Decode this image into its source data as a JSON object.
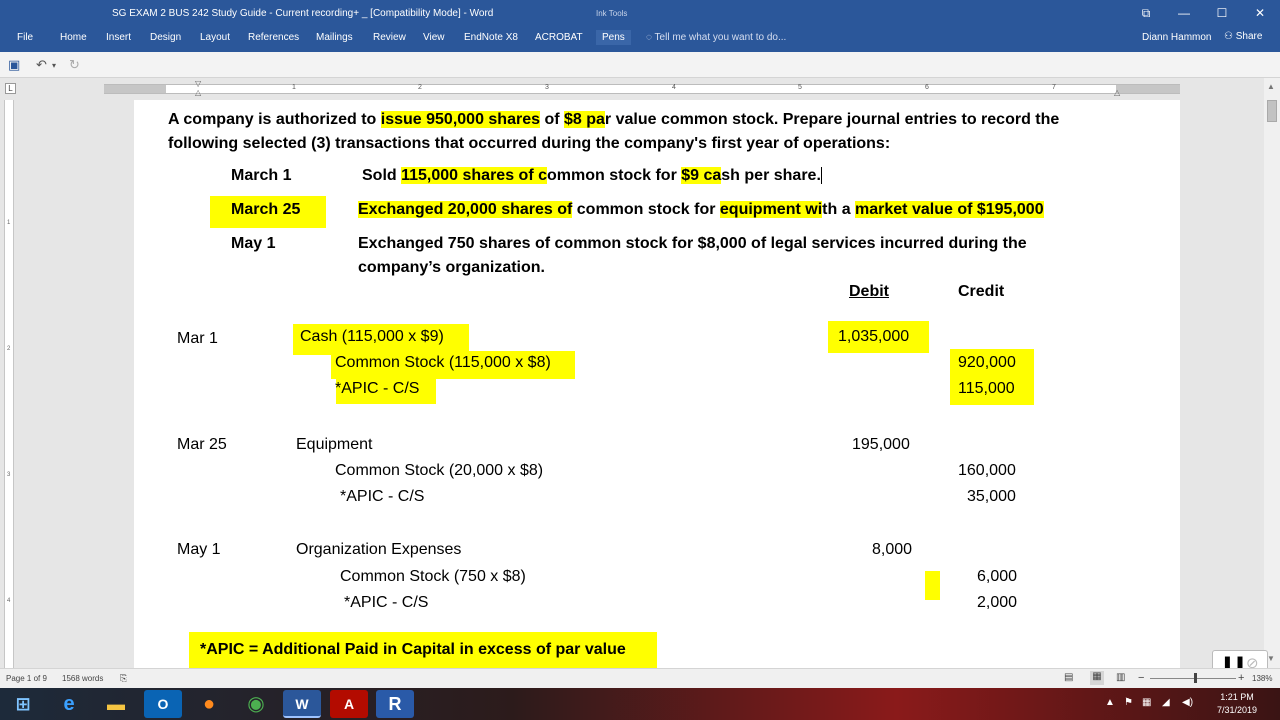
{
  "window": {
    "title": "SG EXAM 2 BUS 242 Study Guide - Current recording+ _ [Compatibility Mode] - Word",
    "ink_tools": "Ink Tools",
    "min": "—",
    "max": "☐",
    "close": "✕",
    "restore": "⧉"
  },
  "ribbon": {
    "tabs": [
      "File",
      "Home",
      "Insert",
      "Design",
      "Layout",
      "References",
      "Mailings",
      "Review",
      "View",
      "EndNote X8",
      "ACROBAT",
      "Pens"
    ],
    "tell_me": "Tell me what you want to do...",
    "user": "Diann Hammon",
    "share": "Share"
  },
  "ruler": {
    "numbers": [
      "1",
      "2",
      "3",
      "4",
      "5",
      "6",
      "7"
    ]
  },
  "vruler": {
    "numbers": [
      "1",
      "2",
      "3",
      "4"
    ]
  },
  "document": {
    "intro": {
      "p1": "A company is authorized to ",
      "p2": "issue 950,000 shares",
      "p3": " of ",
      "p4": "$8 pa",
      "p5": "r value common stock. Prepare journal entries to record the following selected (3) transactions that occurred during the company's first year of operations:"
    },
    "transactions": [
      {
        "date": "March 1",
        "parts": [
          "Sold ",
          "115,000 shares of c",
          "ommon stock for ",
          "$9 ca",
          "sh per share."
        ]
      },
      {
        "date": "March 25",
        "parts": [
          "Exchanged 20,000 shares of",
          " common stock for ",
          "equipment wi",
          "th a ",
          "market value of  $195,000"
        ]
      },
      {
        "date": "May 1",
        "line1": "Exchanged 750 shares of common stock for $8,000 of legal services incurred during the",
        "line2": "company’s organization."
      }
    ],
    "headers": {
      "debit": "Debit",
      "credit": "Credit"
    },
    "entries": [
      {
        "date": "Mar 1",
        "debit_account": "Cash (115,000 x $9)",
        "debit_amount": "1,035,000",
        "credit1_account": "Common Stock (115,000 x $8)",
        "credit1_amount": "920,000",
        "credit2_account": "*APIC - C/S",
        "credit2_amount": "115,000"
      },
      {
        "date": "Mar 25",
        "debit_account": "Equipment",
        "debit_amount": "195,000",
        "credit1_account": "Common Stock (20,000 x $8)",
        "credit1_amount": "160,000",
        "credit2_account": "*APIC - C/S",
        "credit2_amount": "35,000"
      },
      {
        "date": "May 1",
        "debit_account": "Organization Expenses",
        "debit_amount": "8,000",
        "credit1_account": "Common Stock (750 x $8)",
        "credit1_amount": "6,000",
        "credit2_account": "*APIC - C/S",
        "credit2_amount": "2,000"
      }
    ],
    "footnote": "*APIC = Additional Paid in Capital in excess of par value"
  },
  "status": {
    "page": "Page 1 of 9",
    "words": "1568 words",
    "zoom": "138%"
  },
  "taskbar": {
    "time": "1:21 PM",
    "date": "7/31/2019"
  },
  "colors": {
    "highlight": "#ffff00",
    "word_blue": "#2b579a"
  }
}
